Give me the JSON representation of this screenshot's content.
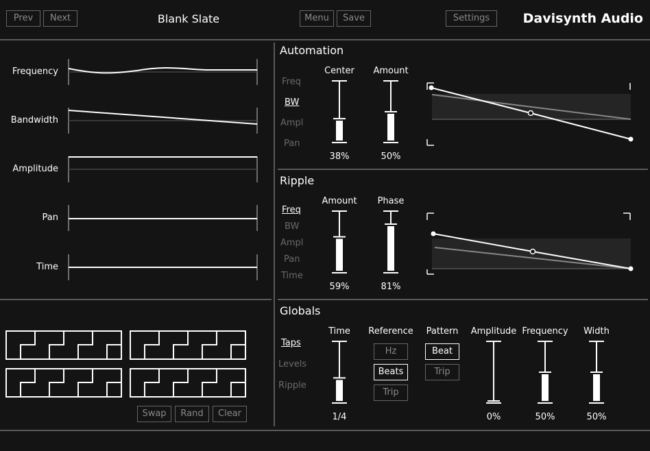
{
  "header": {
    "prev_label": "Prev",
    "next_label": "Next",
    "preset_name": "Blank Slate",
    "menu_label": "Menu",
    "save_label": "Save",
    "settings_label": "Settings",
    "brand": "Davisynth Audio"
  },
  "envelopes": {
    "rows": [
      {
        "label": "Frequency"
      },
      {
        "label": "Bandwidth"
      },
      {
        "label": "Amplitude"
      },
      {
        "label": "Pan"
      },
      {
        "label": "Time"
      }
    ]
  },
  "automation": {
    "title": "Automation",
    "targets": [
      "Freq",
      "BW",
      "Ampl",
      "Pan"
    ],
    "selected": "BW",
    "center_label": "Center",
    "amount_label": "Amount",
    "center_value": "38%",
    "amount_value": "50%",
    "center_level": 0.38,
    "amount_level": 0.5
  },
  "ripple": {
    "title": "Ripple",
    "targets": [
      "Freq",
      "BW",
      "Ampl",
      "Pan",
      "Time"
    ],
    "selected": "Freq",
    "amount_label": "Amount",
    "phase_label": "Phase",
    "amount_value": "59%",
    "phase_value": "81%",
    "amount_level": 0.59,
    "phase_level": 0.81
  },
  "globals": {
    "title": "Globals",
    "tabs": [
      "Taps",
      "Levels",
      "Ripple"
    ],
    "selected_tab": "Taps",
    "time_label": "Time",
    "time_value": "1/4",
    "time_level": 0.4,
    "reference_label": "Reference",
    "reference_options": [
      "Hz",
      "Beats",
      "Trip"
    ],
    "reference_selected": "Beats",
    "pattern_label": "Pattern",
    "pattern_options": [
      "Beat",
      "Trip"
    ],
    "pattern_selected": "Beat",
    "amplitude_label": "Amplitude",
    "amplitude_value": "0%",
    "amplitude_level": 0.0,
    "frequency_label": "Frequency",
    "frequency_value": "50%",
    "frequency_level": 0.5,
    "width_label": "Width",
    "width_value": "50%",
    "width_level": 0.5
  },
  "pattern_grid": {
    "swap_label": "Swap",
    "rand_label": "Rand",
    "clear_label": "Clear"
  }
}
